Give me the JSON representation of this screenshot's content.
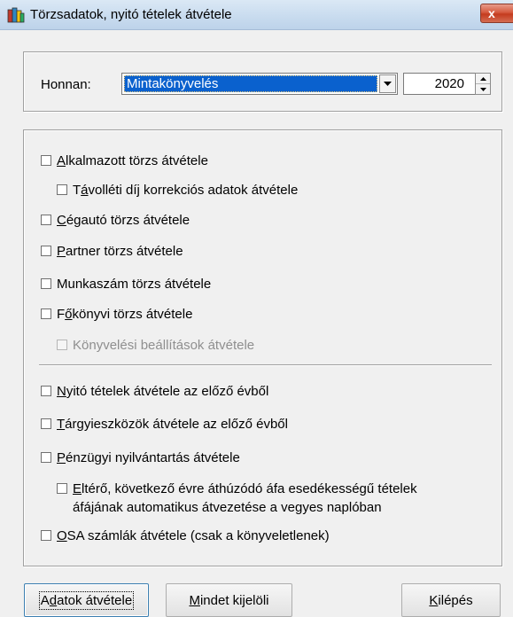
{
  "window": {
    "title": "Törzsadatok, nyitó tételek átvétele",
    "close_glyph": "x"
  },
  "source": {
    "label": "Honnan:",
    "selected_value": "Mintakönyvelés",
    "year": "2020"
  },
  "options": {
    "alkalmazott": {
      "pre": "",
      "key": "A",
      "post": "lkalmazott törzs átvétele",
      "checked": false
    },
    "tavolleti": {
      "pre": "T",
      "key": "á",
      "post": "volléti díj korrekciós adatok átvétele",
      "checked": false
    },
    "cegauto": {
      "pre": "",
      "key": "C",
      "post": "égautó törzs átvétele",
      "checked": false
    },
    "partner": {
      "pre": "",
      "key": "P",
      "post": "artner törzs átvétele",
      "checked": false
    },
    "munkaszam": {
      "pre": "",
      "key": "",
      "post": "Munkaszám törzs átvétele",
      "checked": false
    },
    "fokonyvi": {
      "pre": "F",
      "key": "ő",
      "post": "könyvi törzs átvétele",
      "checked": false
    },
    "konyvelesi": {
      "pre": "",
      "key": "",
      "post": "Könyvelési beállítások átvétele",
      "checked": false,
      "disabled": true
    },
    "nyito": {
      "pre": "",
      "key": "N",
      "post": "yitó tételek átvétele az előző évből",
      "checked": false
    },
    "targyi": {
      "pre": "",
      "key": "T",
      "post": "árgyieszközök átvétele az előző évből",
      "checked": false
    },
    "penzugyi": {
      "pre": "",
      "key": "P",
      "post": "énzügyi nyilvántartás átvétele",
      "checked": false
    },
    "elteró": {
      "pre": "",
      "key": "E",
      "post": "ltérő, következő évre áthúzódó áfa esedékességű tételek",
      "line2": "áfájának automatikus átvezetése a vegyes naplóban",
      "checked": false
    },
    "osa": {
      "pre": "",
      "key": "O",
      "post": "SA számlák átvétele (csak a könyveletlenek)",
      "checked": false
    }
  },
  "buttons": {
    "adatok": {
      "pre": "A",
      "key": "d",
      "post": "atok átvétele"
    },
    "mindet": {
      "pre": "",
      "key": "M",
      "post": "indet kijelöli"
    },
    "kilepes": {
      "pre": "",
      "key": "K",
      "post": "ilépés"
    }
  },
  "icons": {
    "app": "books-icon",
    "combo_arrow": "chevron-down-icon",
    "spin_up": "triangle-up-icon",
    "spin_down": "triangle-down-icon"
  }
}
